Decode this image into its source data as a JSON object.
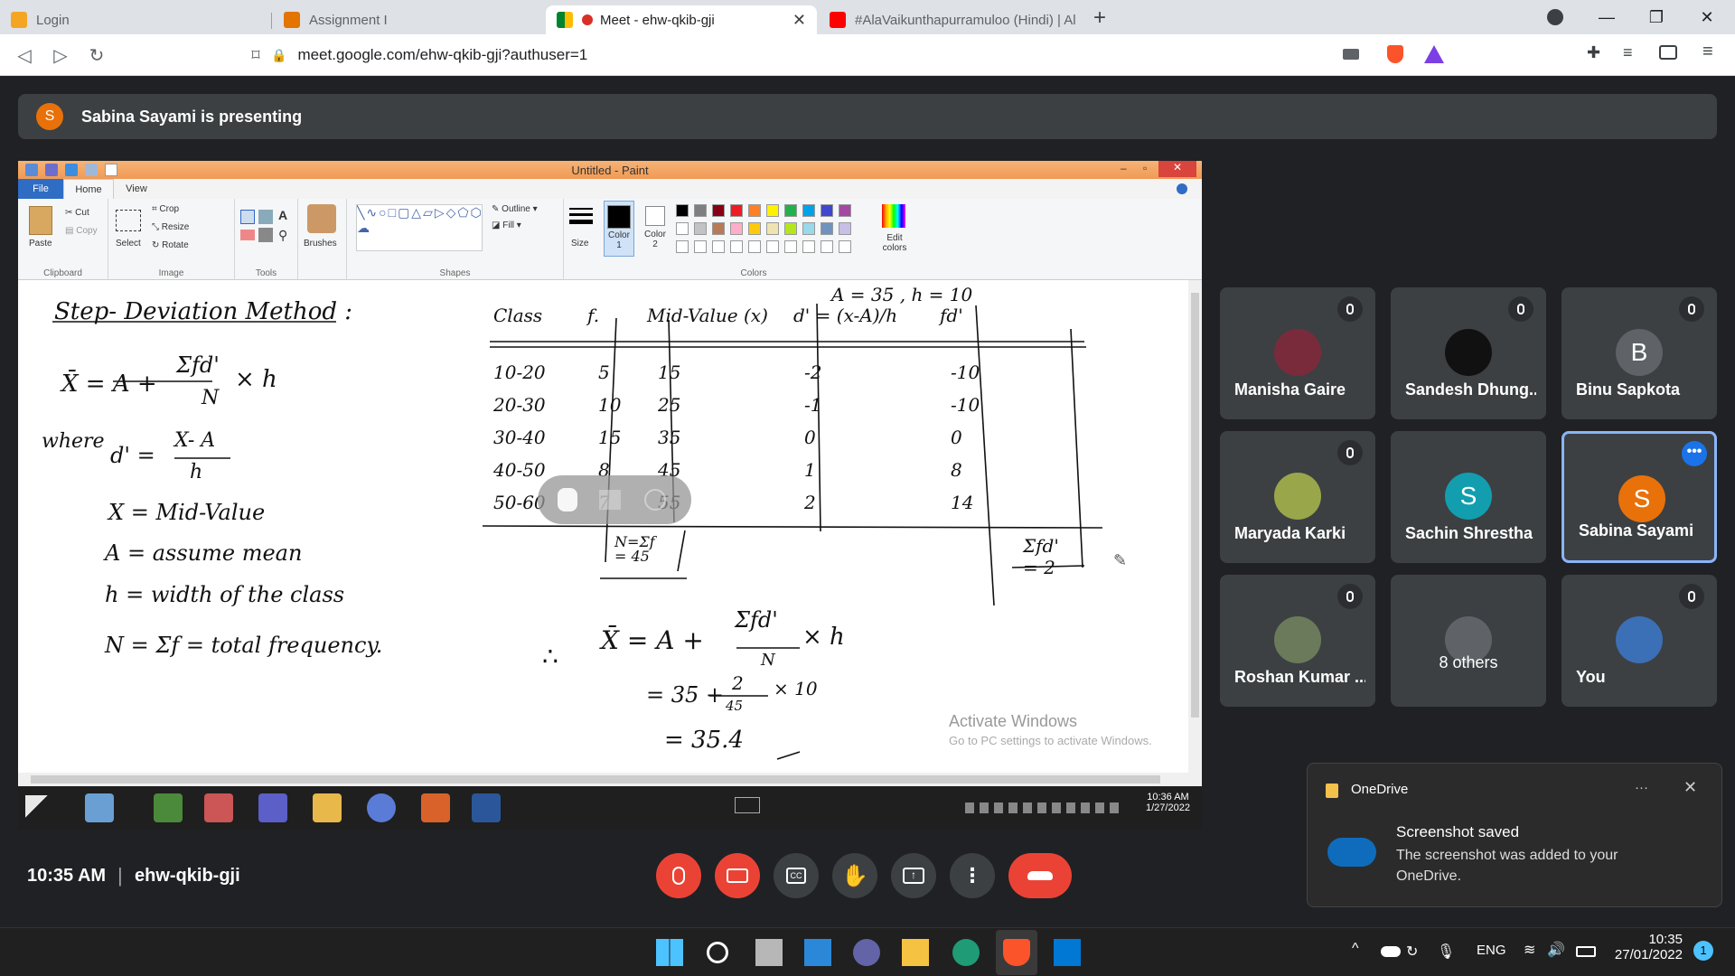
{
  "browser": {
    "tabs": [
      {
        "title": "Login",
        "active": false,
        "icon": "login-favicon"
      },
      {
        "title": "Assignment I",
        "active": false,
        "icon": "assignment-favicon"
      },
      {
        "title": "Meet - ehw-qkib-gji",
        "active": true,
        "icon": "meet-favicon"
      },
      {
        "title": "#AlaVaikunthapurramuloo (Hindi) | All",
        "active": false,
        "icon": "youtube-favicon"
      }
    ],
    "url": "meet.google.com/ehw-qkib-gji?authuser=1"
  },
  "meet": {
    "presenter_initial": "S",
    "presenting_text": "Sabina Sayami is presenting",
    "participants": [
      {
        "name": "Manisha Gaire",
        "avatar": "photo",
        "color": "#7a2b3b",
        "muted": true
      },
      {
        "name": "Sandesh Dhung...",
        "avatar": "photo",
        "color": "#111111",
        "muted": true
      },
      {
        "name": "Binu Sapkota",
        "avatar": "B",
        "color": "#5f6368",
        "muted": true
      },
      {
        "name": "Maryada Karki",
        "avatar": "photo",
        "color": "#9aa64a",
        "muted": true
      },
      {
        "name": "Sachin Shrestha",
        "avatar": "S",
        "color": "#129eaf",
        "muted": false
      },
      {
        "name": "Sabina Sayami",
        "avatar": "S",
        "color": "#e8710a",
        "muted": false
      },
      {
        "name": "Roshan Kumar ...",
        "avatar": "photo",
        "color": "#6b7a5a",
        "muted": true
      },
      {
        "name": "8 others",
        "avatar": "group",
        "color": "#5f6368",
        "muted": false
      },
      {
        "name": "You",
        "avatar": "photo",
        "color": "#3b6fb6",
        "muted": true
      }
    ],
    "time": "10:35 AM",
    "separator": "|",
    "meeting_code": "ehw-qkib-gji"
  },
  "paint": {
    "title": "Untitled - Paint",
    "tabs": [
      "File",
      "Home",
      "View"
    ],
    "clipboard": {
      "paste": "Paste",
      "cut": "Cut",
      "copy": "Copy",
      "label": "Clipboard"
    },
    "image": {
      "select": "Select",
      "crop": "Crop",
      "resize": "Resize",
      "rotate": "Rotate",
      "label": "Image"
    },
    "tools_label": "Tools",
    "brushes": "Brushes",
    "shapes": {
      "outline": "Outline",
      "fill": "Fill",
      "label": "Shapes"
    },
    "size": "Size",
    "color1": "Color\n1",
    "color2": "Color\n2",
    "edit_colors": "Edit colors",
    "colors_label": "Colors",
    "palette_top": [
      "#000000",
      "#7f7f7f",
      "#880015",
      "#ed1c24",
      "#ff7f27",
      "#fff200",
      "#22b14c",
      "#00a2e8",
      "#3f48cc",
      "#a349a4"
    ],
    "palette_bottom": [
      "#ffffff",
      "#c3c3c3",
      "#b97a57",
      "#ffaec9",
      "#ffc90e",
      "#efe4b0",
      "#b5e61d",
      "#99d9ea",
      "#7092be",
      "#c8bfe7"
    ]
  },
  "board": {
    "heading": "Step- Deviation Method :",
    "formula_lhs": "X̄ = A +",
    "formula_num": "Σfd'",
    "formula_den": "N",
    "formula_tail": "× h",
    "where": "where",
    "dprime": "d' =",
    "dnum": "X- A",
    "dden": "h",
    "def_x": "X = Mid-Value",
    "def_a": "A = assume mean",
    "def_h": "h = width of the class",
    "def_n": "N = Σf = total frequency.",
    "assumption": "A = 35 , h = 10",
    "table_headers": [
      "Class",
      "f.",
      "Mid-Value (x)",
      "d' = (x-A)/h",
      "fd'"
    ],
    "table_rows": [
      [
        "10-20",
        "5",
        "15",
        "-2",
        "-10"
      ],
      [
        "20-30",
        "10",
        "25",
        "-1",
        "-10"
      ],
      [
        "30-40",
        "15",
        "35",
        "0",
        "0"
      ],
      [
        "40-50",
        "8",
        "45",
        "1",
        "8"
      ],
      [
        "50-60",
        "7",
        "55",
        "2",
        "14"
      ]
    ],
    "total_f": "N=Σf\n= 45",
    "total_fd": "Σfd'\n= 2",
    "therefore": "∴",
    "result_1": "X̄ = A +",
    "result_1_num": "Σfd'",
    "result_1_den": "N",
    "result_1_tail": "× h",
    "result_2": "= 35 +",
    "result_2_num": "2",
    "result_2_den": "45",
    "result_2_tail": "× 10",
    "result_3": "= 35.4",
    "watermark_title": "Activate Windows",
    "watermark_sub": "Go to PC settings to activate Windows."
  },
  "xp_clock": {
    "time": "10:36 AM",
    "date": "1/27/2022"
  },
  "notification": {
    "app": "OneDrive",
    "more": "···",
    "title": "Screenshot saved",
    "body": "The screenshot was added to your OneDrive."
  },
  "taskbar": {
    "lang": "ENG",
    "time": "10:35",
    "date": "27/01/2022",
    "badge": "1"
  }
}
